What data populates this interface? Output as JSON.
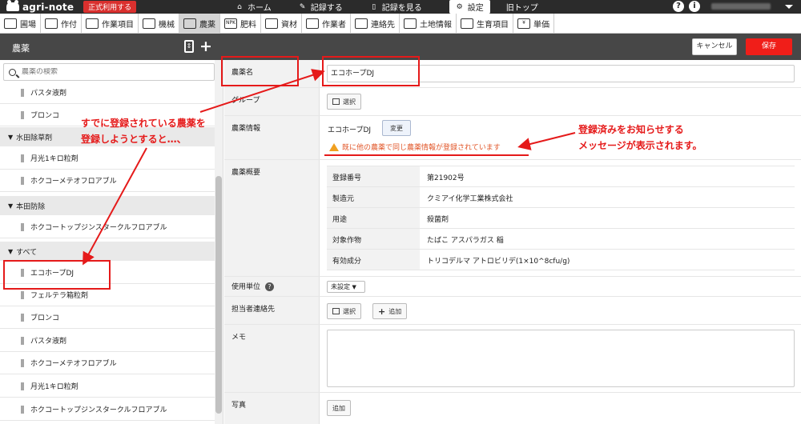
{
  "topbar": {
    "logo_text": "agri-note",
    "badge": "正式利用する",
    "nav": [
      {
        "label": "ホーム",
        "icon": "home-icon"
      },
      {
        "label": "記録する",
        "icon": "pencil-icon"
      },
      {
        "label": "記録を見る",
        "icon": "notebook-icon"
      },
      {
        "label": "設定",
        "icon": "gear-icon",
        "active": true
      },
      {
        "label": "旧トップ",
        "icon": ""
      }
    ],
    "help_glyph": "?",
    "info_glyph": "i"
  },
  "categories": [
    "圃場",
    "作付",
    "作業項目",
    "機械",
    "農薬",
    "肥料",
    "資材",
    "作業者",
    "連絡先",
    "土地情報",
    "生育項目",
    "単価"
  ],
  "category_icon_glyphs": [
    "",
    "",
    "",
    "",
    "",
    "NPK",
    "",
    "",
    "",
    "",
    "",
    "¥"
  ],
  "active_category": "農薬",
  "header": {
    "title": "農薬",
    "cancel_label": "キャンセル",
    "save_label": "保存"
  },
  "sidebar": {
    "search_placeholder": "農薬の検索",
    "rows": [
      {
        "type": "item",
        "label": "パスタ液剤"
      },
      {
        "type": "item",
        "label": "ブロンコ"
      },
      {
        "type": "group",
        "label": "水田除草剤"
      },
      {
        "type": "item",
        "label": "月光1キロ粒剤"
      },
      {
        "type": "item",
        "label": "ホクコーメテオフロアブル"
      },
      {
        "type": "group",
        "label": "本田防除"
      },
      {
        "type": "item",
        "label": "ホクコートップジンスタークルフロアブル"
      },
      {
        "type": "group",
        "label": "すべて"
      },
      {
        "type": "item",
        "label": "エコホープDJ"
      },
      {
        "type": "item",
        "label": "フェルテラ箱粒剤"
      },
      {
        "type": "item",
        "label": "ブロンコ"
      },
      {
        "type": "item",
        "label": "パスタ液剤"
      },
      {
        "type": "item",
        "label": "ホクコーメテオフロアブル"
      },
      {
        "type": "item",
        "label": "月光1キロ粒剤"
      },
      {
        "type": "item",
        "label": "ホクコートップジンスタークルフロアブル"
      }
    ]
  },
  "form": {
    "name_label": "農薬名",
    "name_value": "エコホープDJ",
    "group_label": "グループ",
    "select_label": "選択",
    "info_label": "農薬情報",
    "info_value": "エコホープDJ",
    "change_label": "変更",
    "warning": "既に他の農薬で同じ農薬情報が登録されています",
    "summary_label": "農薬概要",
    "summary": [
      {
        "key": "登録番号",
        "value": "第21902号"
      },
      {
        "key": "製造元",
        "value": "クミアイ化学工業株式会社"
      },
      {
        "key": "用途",
        "value": "殺菌剤"
      },
      {
        "key": "対象作物",
        "value": "たばこ アスパラガス 稲"
      },
      {
        "key": "有効成分",
        "value": "トリコデルマ アトロビリデ(1×10^8cfu/g)"
      }
    ],
    "unit_label": "使用単位",
    "unit_value": "未設定",
    "help_glyph": "?",
    "contact_label": "担当者連絡先",
    "add_label": "追加",
    "memo_label": "メモ",
    "photo_label": "写真",
    "photo_add_label": "追加"
  },
  "annotations": {
    "left_line1": "すでに登録されている農薬を",
    "left_line2": "登録しようとすると…、",
    "right_line1": "登録済みをお知らせする",
    "right_line2": "メッセージが表示されます。",
    "color": "#e51a1a"
  }
}
